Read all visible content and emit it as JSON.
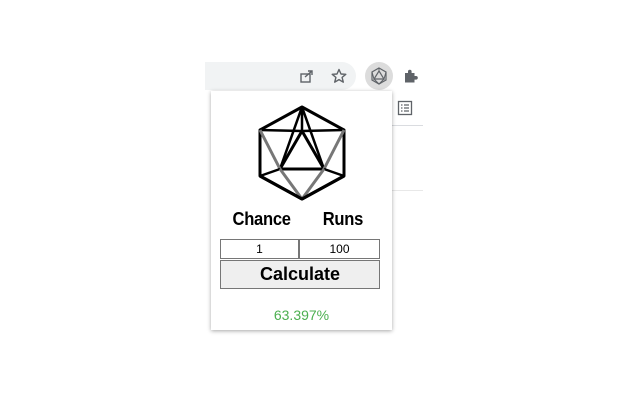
{
  "toolbar": {
    "icons": [
      "share-icon",
      "star-icon",
      "d20-extension-icon",
      "puzzle-icon"
    ]
  },
  "popup": {
    "die_icon": "icosahedron-icon",
    "chance_label": "Chance",
    "runs_label": "Runs",
    "chance_value": "1",
    "runs_value": "100",
    "calculate_label": "Calculate",
    "result": "63.397%",
    "result_color": "#4caf50"
  }
}
